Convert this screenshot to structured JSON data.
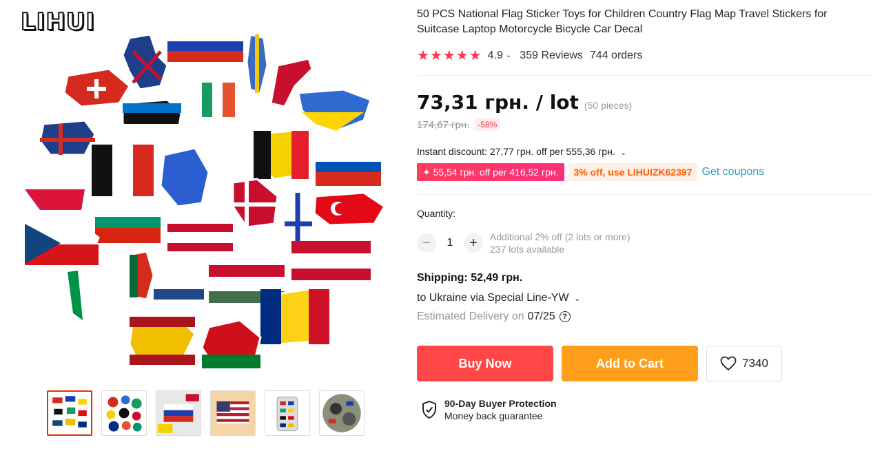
{
  "gallery": {
    "brand": "LIHUI",
    "thumbnails": [
      "thumb-1",
      "thumb-2",
      "thumb-3",
      "thumb-4",
      "thumb-5",
      "thumb-6"
    ],
    "active_thumbnail": 1
  },
  "product": {
    "title": "50 PCS National Flag Sticker Toys for Children Country Flag Map Travel Stickers for Suitcase Laptop Motorcycle Bicycle Car Decal",
    "stars": "★★★★★",
    "rating": "4.9",
    "reviews": "359 Reviews",
    "orders": "744 orders"
  },
  "price": {
    "current": "73,31 грн. / lot",
    "pieces": "(50 pieces)",
    "original": "174,67 грн.",
    "discount": "-58%"
  },
  "promo": {
    "instant_discount": "Instant discount: 27,77 грн. off per 555,36 грн.",
    "coupon_store": "✦ 55,54 грн. off per 416,52 грн.",
    "coupon_code": "3% off, use LIHUIZK62397",
    "get_coupons": "Get coupons"
  },
  "quantity": {
    "label": "Quantity:",
    "value": "1",
    "minus": "−",
    "plus": "+",
    "note_discount": "Additional 2% off (2 lots or more)",
    "note_available": "237 lots available"
  },
  "shipping": {
    "title": "Shipping: 52,49 грн.",
    "via": "to Ukraine via Special Line-YW",
    "estimated_label": "Estimated Delivery on",
    "estimated_date": "07/25"
  },
  "actions": {
    "buy_now": "Buy Now",
    "add_to_cart": "Add to Cart",
    "wishlist_count": "7340"
  },
  "protection": {
    "title": "90-Day Buyer Protection",
    "subtitle": "Money back guarantee"
  },
  "colors": {
    "accent_red": "#ff4747",
    "accent_orange": "#ff9e1b",
    "star_red": "#fd384f",
    "link_blue": "#2e9cc3"
  },
  "icons": [
    "chevron-down-icon",
    "help-icon",
    "heart-icon",
    "shield-check-icon",
    "star-icon"
  ]
}
